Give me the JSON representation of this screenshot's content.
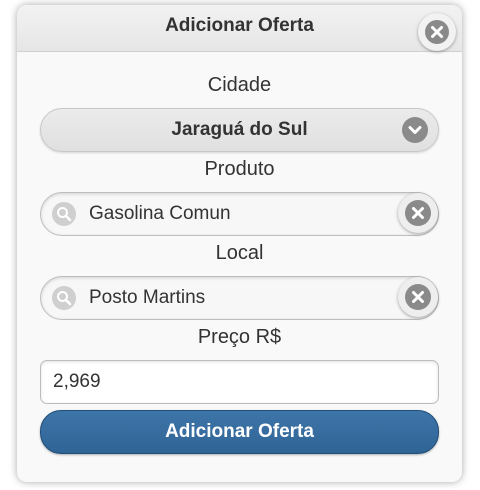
{
  "dialog": {
    "title": "Adicionar Oferta"
  },
  "form": {
    "cidade_label": "Cidade",
    "cidade_value": "Jaraguá do Sul",
    "produto_label": "Produto",
    "produto_value": "Gasolina Comun",
    "local_label": "Local",
    "local_value": "Posto Martins",
    "preco_label": "Preço R$",
    "preco_value": "2,969",
    "submit_label": "Adicionar Oferta"
  },
  "icons": {
    "close": "close-icon",
    "dropdown": "chevron-down-icon",
    "search": "search-icon",
    "clear": "clear-icon"
  },
  "colors": {
    "primary_button": "#3a6fa0",
    "icon_gray": "#8a8a8a"
  }
}
